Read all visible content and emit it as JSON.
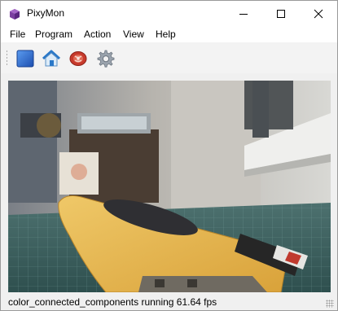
{
  "window": {
    "title": "PixyMon"
  },
  "menu": {
    "items": [
      {
        "label": "File"
      },
      {
        "label": "Program"
      },
      {
        "label": "Action"
      },
      {
        "label": "View"
      },
      {
        "label": "Help"
      }
    ]
  },
  "toolbar": {
    "icons": [
      "stop-icon",
      "home-icon",
      "raw-video-icon",
      "settings-gear-icon"
    ]
  },
  "status": {
    "text": "color_connected_components running 61.64 fps"
  },
  "colors": {
    "accent_blue": "#2f6fd1",
    "target_yellow": "#e8b84a"
  }
}
